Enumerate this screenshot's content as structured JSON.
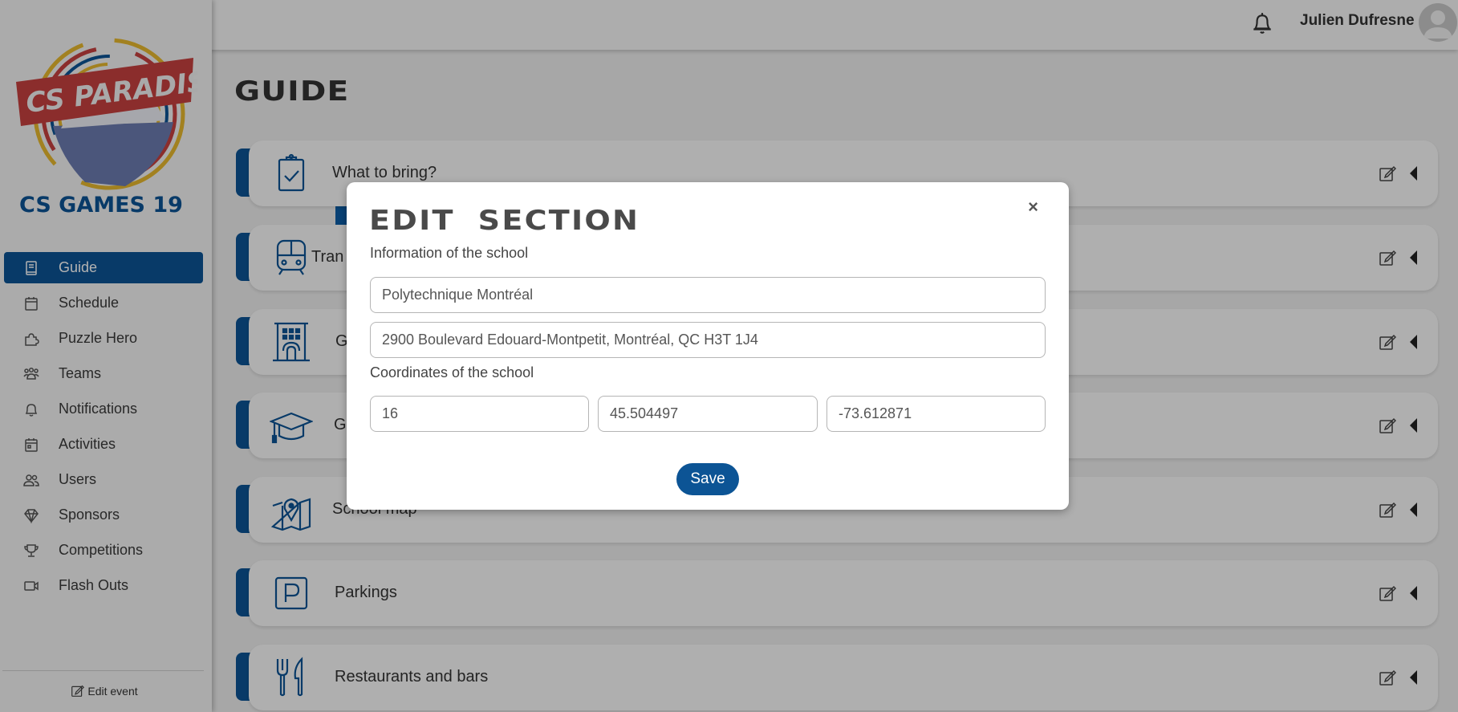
{
  "topbar": {
    "user_name": "Julien Dufresne",
    "bell_icon": "bell-icon",
    "avatar_icon": "user-avatar-icon"
  },
  "sidebar": {
    "logo": {
      "top_text": "CS PARADISE",
      "bottom_text": "CS GAMES 19"
    },
    "items": [
      {
        "label": "Guide",
        "icon": "book-icon",
        "active": true
      },
      {
        "label": "Schedule",
        "icon": "calendar-icon",
        "active": false
      },
      {
        "label": "Puzzle Hero",
        "icon": "puzzle-icon",
        "active": false
      },
      {
        "label": "Teams",
        "icon": "group-icon",
        "active": false
      },
      {
        "label": "Notifications",
        "icon": "bell-icon",
        "active": false
      },
      {
        "label": "Activities",
        "icon": "calendar-event-icon",
        "active": false
      },
      {
        "label": "Users",
        "icon": "users-icon",
        "active": false
      },
      {
        "label": "Sponsors",
        "icon": "diamond-icon",
        "active": false
      },
      {
        "label": "Competitions",
        "icon": "trophy-icon",
        "active": false
      },
      {
        "label": "Flash Outs",
        "icon": "video-camera-icon",
        "active": false
      }
    ],
    "edit_event_label": "Edit event"
  },
  "main": {
    "page_title": "GUIDE",
    "sections": [
      {
        "label": "What to bring?",
        "icon": "clipboard-check-icon"
      },
      {
        "label": "Tran",
        "icon": "train-icon"
      },
      {
        "label": "Ge",
        "icon": "building-icon"
      },
      {
        "label": "Ge",
        "icon": "graduation-cap-icon"
      },
      {
        "label": "School map",
        "icon": "map-pin-icon"
      },
      {
        "label": "Parkings",
        "icon": "parking-icon"
      },
      {
        "label": "Restaurants and bars",
        "icon": "utensils-icon"
      }
    ]
  },
  "modal": {
    "title": "EDIT SECTION",
    "close_label": "×",
    "info_label": "Information of the school",
    "school_name": "Polytechnique Montréal",
    "school_address": "2900 Boulevard Edouard-Montpetit, Montréal, QC H3T 1J4",
    "coords_label": "Coordinates of the school",
    "zoom": "16",
    "latitude": "45.504497",
    "longitude": "-73.612871",
    "save_label": "Save"
  },
  "colors": {
    "primary": "#0c5495",
    "logo_red": "#c8413f",
    "logo_yellow": "#e8b92e"
  }
}
